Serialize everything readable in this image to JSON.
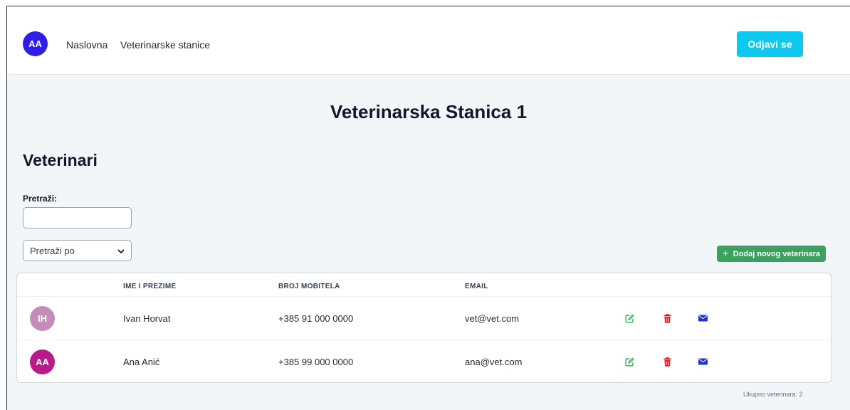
{
  "header": {
    "avatar_initials": "AA",
    "nav": {
      "home": "Naslovna",
      "stations": "Veterinarske stanice"
    },
    "logout_label": "Odjavi se"
  },
  "page": {
    "title": "Veterinarska Stanica 1",
    "section_title": "Veterinari"
  },
  "search": {
    "label": "Pretraži:",
    "input_value": "",
    "select_value": "Pretraži po"
  },
  "add_button_label": "Dodaj novog veterinara",
  "table": {
    "headers": {
      "name": "IME I PREZIME",
      "phone": "BROJ MOBITELA",
      "email": "EMAIL"
    },
    "rows": [
      {
        "initials": "IH",
        "name": "Ivan Horvat",
        "phone": "+385 91 000 0000",
        "email": "vet@vet.com",
        "avatar_color": "#c48cb8"
      },
      {
        "initials": "AA",
        "name": "Ana Anić",
        "phone": "+385 99 000 0000",
        "email": "ana@vet.com",
        "avatar_color": "#b81a8a"
      }
    ]
  },
  "total_text": "Ukupno veterinara: 2",
  "colors": {
    "brand_avatar": "#2f1ee8",
    "logout": "#0fc8ef",
    "add": "#3aa15e",
    "edit": "#2fb24e",
    "delete": "#e11d1d",
    "mail": "#2031d9"
  },
  "icons": {
    "edit": "edit-icon",
    "delete": "trash-icon",
    "mail": "envelope-icon",
    "add": "plus-icon",
    "select": "chevron-down-icon"
  }
}
